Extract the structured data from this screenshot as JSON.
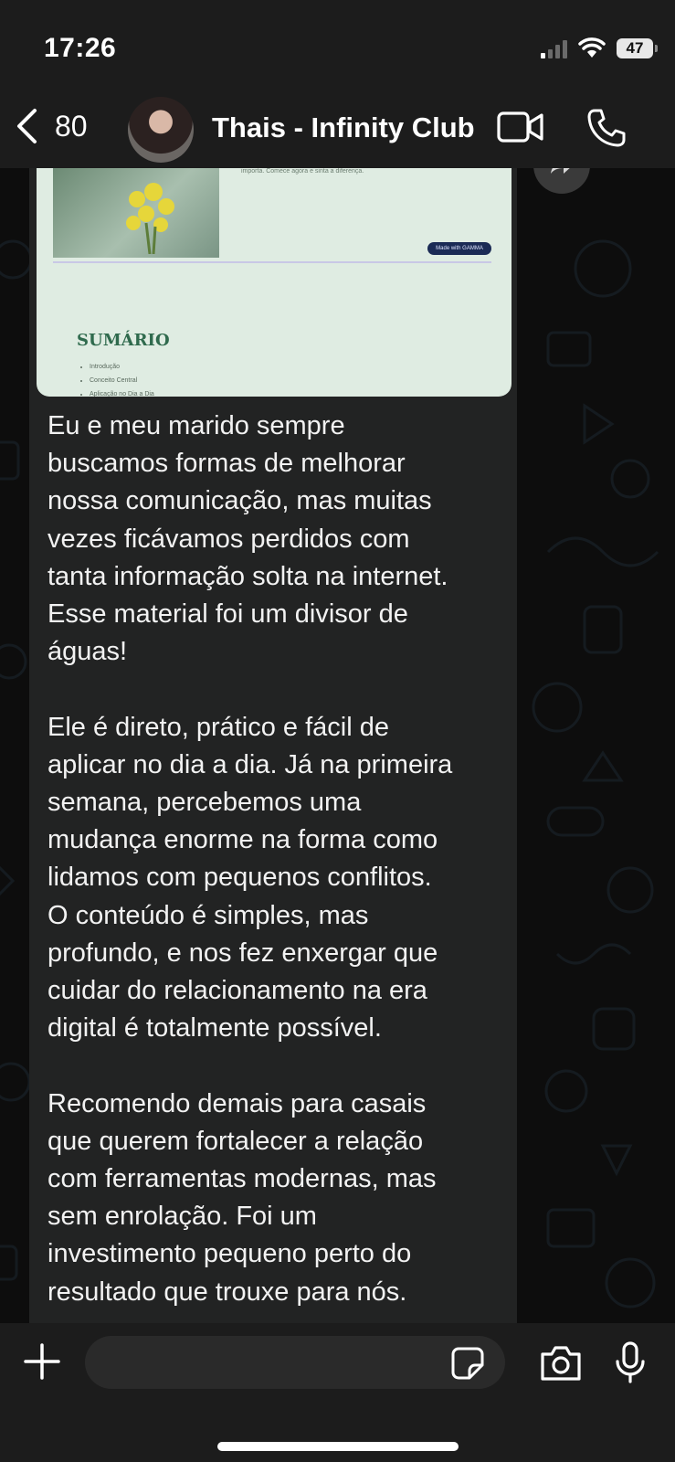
{
  "status_bar": {
    "time": "17:26",
    "battery": "47",
    "icons": [
      "cellular-signal-icon",
      "wifi-icon",
      "battery-icon"
    ]
  },
  "header": {
    "back_count": "80",
    "contact_name": "Thais - Infinity Club",
    "icons": [
      "chevron-left-icon",
      "video-camera-icon",
      "phone-icon"
    ]
  },
  "message": {
    "preview": {
      "caption": "importa. Comece agora e sinta a diferença.",
      "made_with": "Made with GAMMA",
      "heading": "SUMÁRIO",
      "items": [
        "Introdução",
        "Conceito Central",
        "Aplicação no Dia a Dia"
      ]
    },
    "text": "Eu e meu marido sempre\nbuscamos formas de melhorar\nnossa comunicação, mas muitas\nvezes ficávamos perdidos com\ntanta informação solta na internet.\nEsse material foi um divisor de\náguas!\n\nEle é direto, prático e fácil de\naplicar no dia a dia. Já na primeira\nsemana, percebemos uma\nmudança enorme na forma como\nlidamos com pequenos conflitos.\nO conteúdo é simples, mas\nprofundo, e nos fez enxergar que\ncuidar do relacionamento na era\ndigital é totalmente possível.\n\nRecomendo demais para casais\nque querem fortalecer a relação\ncom ferramentas modernas, mas\nsem enrolação. Foi um\ninvestimento pequeno perto do\nresultado que trouxe para nós."
  },
  "input_bar": {
    "placeholder": "",
    "icons": [
      "plus-icon",
      "sticker-icon",
      "camera-icon",
      "microphone-icon"
    ]
  },
  "colors": {
    "background": "#0b0b0b",
    "bar": "#1c1c1c",
    "bubble": "#222323",
    "text": "#f2f2f2"
  }
}
